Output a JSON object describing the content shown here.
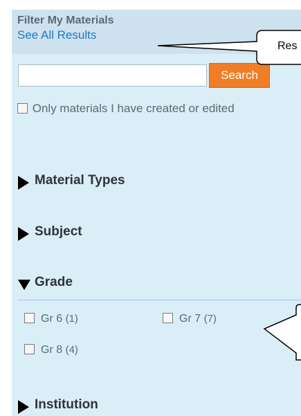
{
  "filter_panel": {
    "title": "Filter My Materials",
    "see_all_link": "See All Results",
    "search": {
      "input_value": "",
      "placeholder": "",
      "button_label": "Search"
    },
    "only_mine_checkbox": {
      "label": "Only materials I have created or edited",
      "checked": false
    },
    "sections": [
      {
        "label": "Material Types",
        "expanded": false
      },
      {
        "label": "Subject",
        "expanded": false
      },
      {
        "label": "Grade",
        "expanded": true
      },
      {
        "label": "Institution",
        "expanded": false
      }
    ],
    "grade_options": [
      {
        "label": "Gr 6",
        "count": "(1)",
        "checked": false
      },
      {
        "label": "Gr 7",
        "count": "(7)",
        "checked": false
      },
      {
        "label": "Gr 8",
        "count": "(4)",
        "checked": false
      }
    ]
  },
  "callout": {
    "text": "Res"
  },
  "colors": {
    "panel_bg": "#daeef8",
    "header_bg": "#cde2ee",
    "link": "#1f78c6",
    "search_button": "#f07e26"
  }
}
